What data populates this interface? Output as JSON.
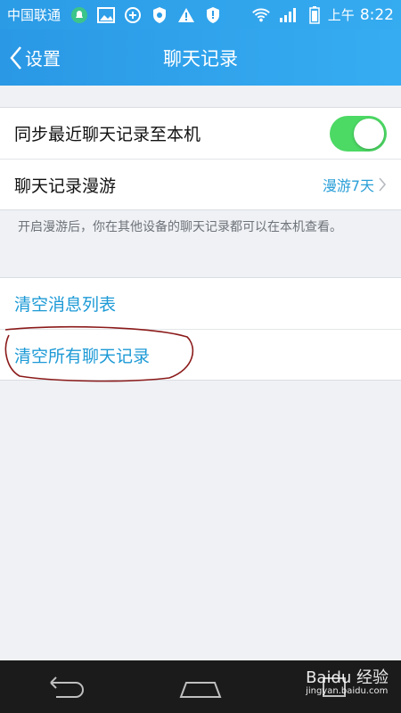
{
  "status": {
    "carrier": "中国联通",
    "time_period": "上午",
    "time": "8:22",
    "icons": [
      "bell-icon",
      "image-icon",
      "sync-icon",
      "shield-icon",
      "warning-icon",
      "shield-alert-icon",
      "wifi-icon",
      "signal-icon",
      "battery-icon"
    ]
  },
  "nav": {
    "back_label": "设置",
    "title": "聊天记录"
  },
  "settings": {
    "sync_label": "同步最近聊天记录至本机",
    "sync_enabled": true,
    "roam_label": "聊天记录漫游",
    "roam_value": "漫游7天",
    "roam_note": "开启漫游后，你在其他设备的聊天记录都可以在本机查看。"
  },
  "actions": {
    "clear_list": "清空消息列表",
    "clear_all": "清空所有聊天记录"
  },
  "watermark": {
    "brand": "Baidu 经验",
    "url": "jingyan.baidu.com"
  },
  "colors": {
    "accent": "#1d9ad6",
    "toggle_on": "#4cd964",
    "header": "#2a98e5"
  }
}
